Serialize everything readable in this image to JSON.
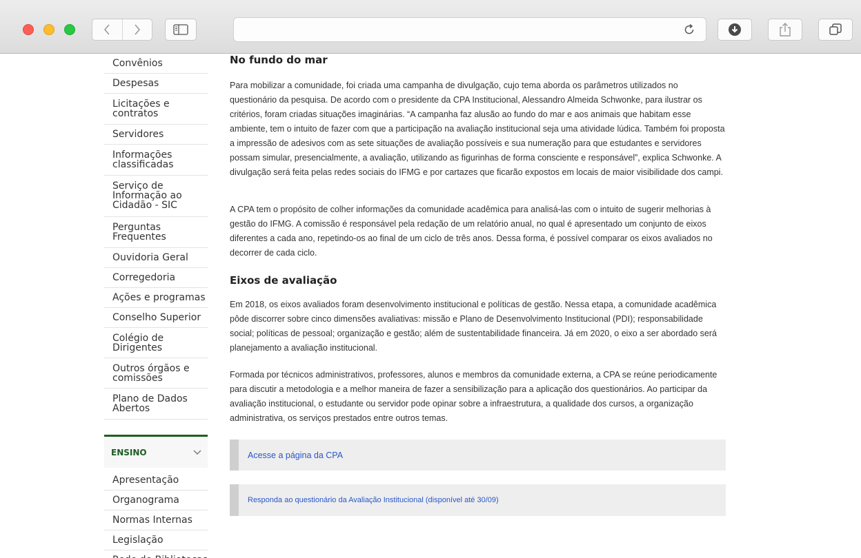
{
  "sidebar_nav": {
    "items": [
      "Convênios",
      "Despesas",
      "Licitações e contratos",
      "Servidores",
      "Informações classificadas",
      "Serviço de Informação ao Cidadão - SIC",
      "Perguntas Frequentes",
      "Ouvidoria Geral",
      "Corregedoria",
      "Ações e programas",
      "Conselho Superior",
      "Colégio de Dirigentes",
      "Outros órgãos e comissões",
      "Plano de Dados Abertos"
    ],
    "section_ensino": {
      "title": "ENSINO",
      "items": [
        "Apresentação",
        "Organograma",
        "Normas Internas",
        "Legislação",
        "Rede de Bibliotecas"
      ]
    }
  },
  "article": {
    "heading1": "No fundo do mar",
    "para1": "Para mobilizar a comunidade, foi criada uma campanha de divulgação, cujo tema aborda os parâmetros utilizados no questionário da pesquisa. De acordo com o presidente da CPA Institucional, Alessandro Almeida Schwonke, para ilustrar os critérios, foram criadas situações imaginárias. “A campanha faz alusão ao fundo do mar e aos animais que habitam esse ambiente, tem o intuito de fazer com que a participação na avaliação institucional seja uma atividade lúdica. Também foi proposta a impressão de adesivos com as sete situações de avaliação possíveis e sua numeração para que estudantes e servidores possam simular, presencialmente, a avaliação, utilizando as figurinhas de forma consciente e responsável”, explica Schwonke. A divulgação será feita pelas redes sociais do IFMG e por cartazes que ficarão expostos em locais de maior visibilidade dos campi.",
    "para2": "A CPA tem o propósito de colher informações da comunidade acadêmica para analisá-las com o intuito de sugerir melhorias à gestão do IFMG. A comissão é responsável pela redação de um relatório anual, no qual é apresentado um conjunto de eixos diferentes a cada ano, repetindo-os ao final de um ciclo de três anos. Dessa forma, é possível comparar os eixos avaliados no decorrer de cada ciclo.",
    "heading2": "Eixos de avaliação",
    "para3": "Em 2018, os eixos avaliados foram desenvolvimento institucional e políticas de gestão. Nessa etapa, a comunidade acadêmica pôde discorrer sobre cinco dimensões avaliativas: missão e Plano de Desenvolvimento Institucional (PDI); responsabilidade social; políticas de pessoal; organização e gestão; além de sustentabilidade financeira. Já em 2020, o eixo a ser abordado será planejamento a avaliação institucional.",
    "para4": "Formada por técnicos administrativos, professores, alunos e membros da comunidade externa, a CPA se reúne periodicamente para discutir a metodologia e a melhor maneira de fazer a sensibilização para a aplicação dos questionários. Ao participar da avaliação institucional, o estudante ou servidor pode opinar sobre a infraestrutura, a qualidade dos cursos, a organização administrativa, os serviços prestados entre outros temas.",
    "link1": "Acesse a página da CPA",
    "link2": "Responda ao questionário da Avaliação Institucional (disponível até 30/09)"
  }
}
